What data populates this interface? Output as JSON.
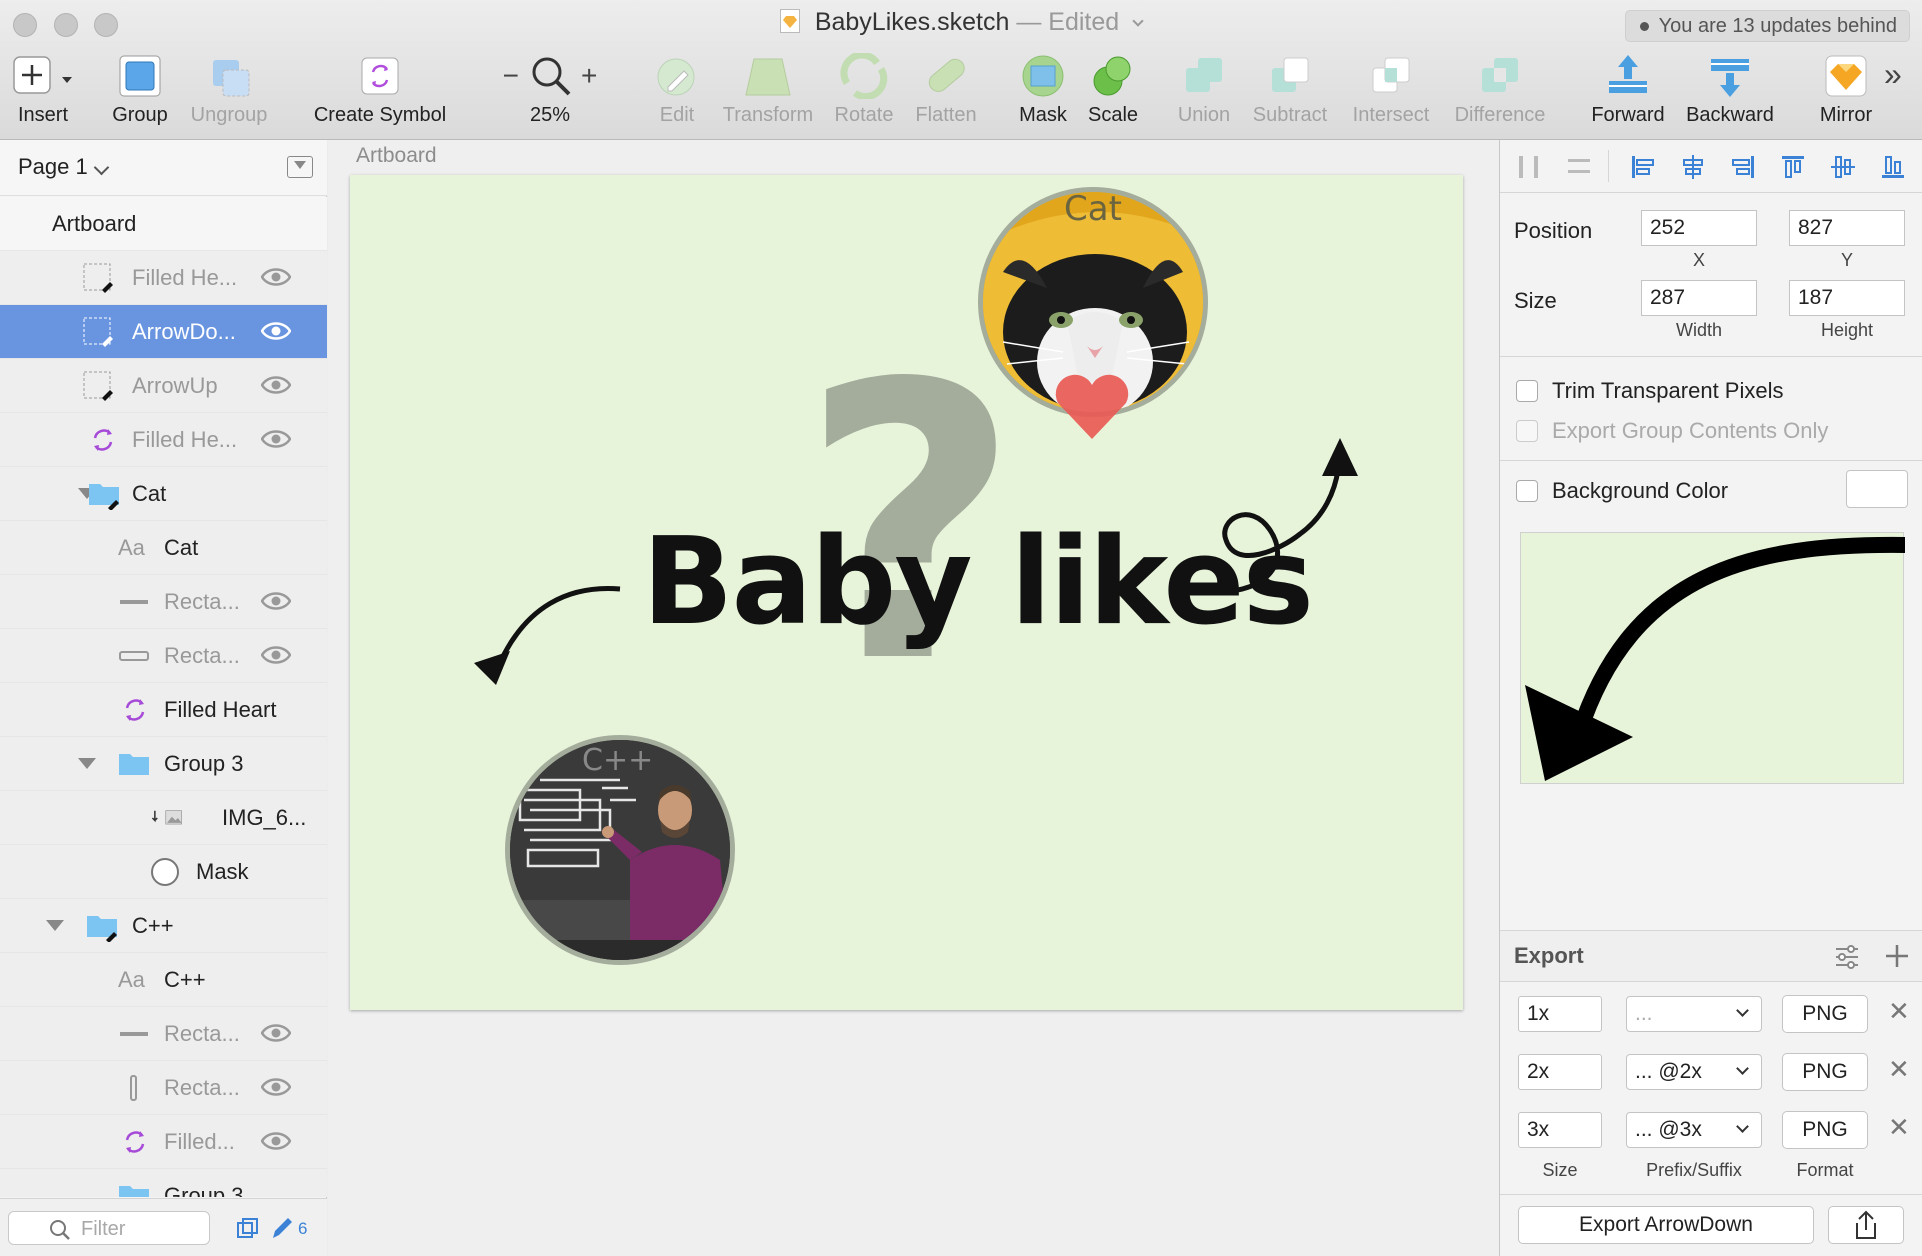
{
  "window": {
    "title": "BabyLikes.sketch",
    "edited": "— Edited",
    "updates_notice": "You are 13 updates behind"
  },
  "toolbar": {
    "insert": "Insert",
    "group": "Group",
    "ungroup": "Ungroup",
    "create_symbol": "Create Symbol",
    "zoom": "25%",
    "edit": "Edit",
    "transform": "Transform",
    "rotate": "Rotate",
    "flatten": "Flatten",
    "mask": "Mask",
    "scale": "Scale",
    "union": "Union",
    "subtract": "Subtract",
    "intersect": "Intersect",
    "difference": "Difference",
    "forward": "Forward",
    "backward": "Backward",
    "mirror": "Mirror",
    "more": "»"
  },
  "sidebar": {
    "page": "Page 1",
    "layers": [
      {
        "label": "Artboard"
      },
      {
        "label": "Filled He..."
      },
      {
        "label": "ArrowDo..."
      },
      {
        "label": "ArrowUp"
      },
      {
        "label": "Filled He..."
      },
      {
        "label": "Cat"
      },
      {
        "label": "Cat",
        "type_glyph": "Aa"
      },
      {
        "label": "Recta..."
      },
      {
        "label": "Recta..."
      },
      {
        "label": "Filled Heart"
      },
      {
        "label": "Group 3"
      },
      {
        "label": "IMG_6..."
      },
      {
        "label": "Mask"
      },
      {
        "label": "C++"
      },
      {
        "label": "C++",
        "type_glyph": "Aa"
      },
      {
        "label": "Recta..."
      },
      {
        "label": "Recta..."
      },
      {
        "label": "Filled..."
      },
      {
        "label": "Group 3"
      }
    ],
    "filter_placeholder": "Filter",
    "edited_count": "6"
  },
  "canvas": {
    "artboard_label": "Artboard",
    "headline": "Baby likes",
    "cat_caption": "Cat",
    "cpp_caption": "C++",
    "question_glyph": "?"
  },
  "inspector": {
    "position_label": "Position",
    "x": "252",
    "y": "827",
    "x_label": "X",
    "y_label": "Y",
    "size_label": "Size",
    "width": "287",
    "height": "187",
    "width_label": "Width",
    "height_label": "Height",
    "trim_transparent": "Trim Transparent Pixels",
    "export_group_only": "Export Group Contents Only",
    "background_color": "Background Color",
    "export_title": "Export",
    "export_rows": [
      {
        "size": "1x",
        "suffix": "...",
        "format": "PNG"
      },
      {
        "size": "2x",
        "suffix": "... @2x",
        "format": "PNG"
      },
      {
        "size": "3x",
        "suffix": "... @3x",
        "format": "PNG"
      }
    ],
    "col_size": "Size",
    "col_prefix": "Prefix/Suffix",
    "col_format": "Format",
    "export_button": "Export ArrowDown"
  },
  "colors": {
    "accent": "#6894e0",
    "artboard_bg": "#e8f4da",
    "question_mark": "#a4ad9c"
  }
}
